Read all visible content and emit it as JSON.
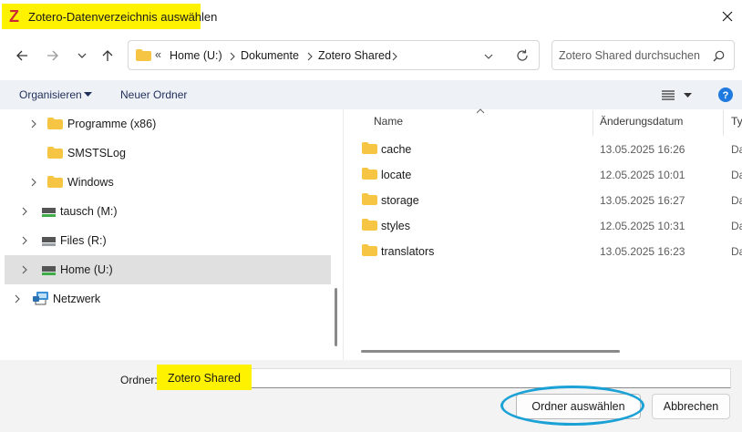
{
  "window": {
    "title": "Zotero-Datenverzeichnis auswählen",
    "app_icon_letter": "Z",
    "highlight_color": "#fff200"
  },
  "address_bar": {
    "overflow": "«",
    "breadcrumbs": [
      "Home (U:)",
      "Dokumente",
      "Zotero Shared"
    ]
  },
  "search": {
    "placeholder": "Zotero Shared durchsuchen"
  },
  "toolbar": {
    "organize_label": "Organisieren",
    "new_folder_label": "Neuer Ordner"
  },
  "tree": {
    "items": [
      {
        "label": "Programme (x86)",
        "icon": "folder-icon",
        "expandable": true
      },
      {
        "label": "SMSTSLog",
        "icon": "folder-icon",
        "expandable": false
      },
      {
        "label": "Windows",
        "icon": "folder-icon",
        "expandable": true
      },
      {
        "label": "tausch (M:)",
        "icon": "network-drive-icon",
        "expandable": true
      },
      {
        "label": "Files (R:)",
        "icon": "network-drive-icon",
        "expandable": true
      },
      {
        "label": "Home (U:)",
        "icon": "network-drive-icon",
        "expandable": true,
        "selected": true
      },
      {
        "label": "Netzwerk",
        "icon": "network-icon",
        "expandable": true
      }
    ]
  },
  "file_list": {
    "columns": {
      "name": "Name",
      "date": "Änderungsdatum",
      "type": "Ty"
    },
    "rows": [
      {
        "name": "cache",
        "date": "13.05.2025 16:26",
        "type": "Da"
      },
      {
        "name": "locate",
        "date": "12.05.2025 10:01",
        "type": "Da"
      },
      {
        "name": "storage",
        "date": "13.05.2025 16:27",
        "type": "Da"
      },
      {
        "name": "styles",
        "date": "12.05.2025 10:31",
        "type": "Da"
      },
      {
        "name": "translators",
        "date": "13.05.2025 16:23",
        "type": "Da"
      }
    ]
  },
  "footer": {
    "folder_label": "Ordner:",
    "folder_value": "Zotero Shared",
    "select_button": "Ordner auswählen",
    "cancel_button": "Abbrechen"
  },
  "colors": {
    "accent_circle": "#1ba1d6",
    "folder": "#f5c543",
    "help": "#1f7ae0"
  }
}
